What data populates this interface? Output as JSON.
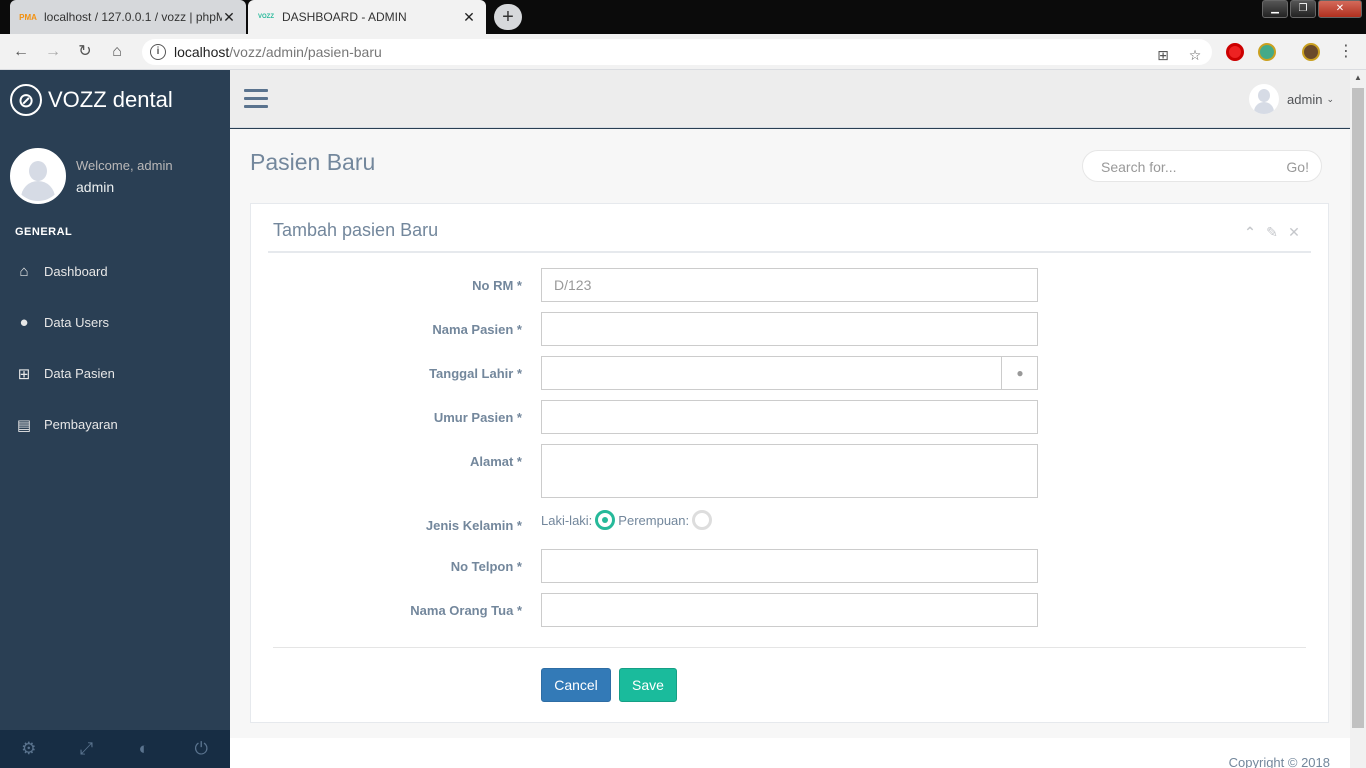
{
  "browser": {
    "tabs": [
      {
        "title": "localhost / 127.0.0.1 / vozz | phpMyAdmin",
        "favicon": "pma-icon",
        "active": false
      },
      {
        "title": "DASHBOARD - ADMIN",
        "favicon": "vozz-icon",
        "active": true
      }
    ],
    "url_host": "localhost",
    "url_path": "/vozz/admin/pasien-baru",
    "pma_favicon_text": "PMA",
    "vozz_favicon_text": "VOZZ"
  },
  "sidebar": {
    "brand": "VOZZ dental",
    "welcome": "Welcome, admin",
    "username": "admin",
    "section": "GENERAL",
    "items": [
      {
        "label": "Dashboard",
        "icon": "home-icon"
      },
      {
        "label": "Data Users",
        "icon": "user-icon"
      },
      {
        "label": "Data Pasien",
        "icon": "medkit-icon"
      },
      {
        "label": "Pembayaran",
        "icon": "file-icon"
      }
    ],
    "footer_icons": [
      "settings-icon",
      "fullscreen-icon",
      "lock-icon",
      "logout-icon"
    ]
  },
  "topnav": {
    "user": "admin"
  },
  "page": {
    "title": "Pasien Baru",
    "search_placeholder": "Search for...",
    "search_button": "Go!"
  },
  "panel": {
    "title": "Tambah pasien Baru",
    "fields": {
      "no_rm": {
        "label": "No RM *",
        "value": "",
        "placeholder": "D/123"
      },
      "nama": {
        "label": "Nama Pasien *",
        "value": ""
      },
      "tanggal": {
        "label": "Tanggal Lahir *",
        "value": ""
      },
      "umur": {
        "label": "Umur Pasien *",
        "value": ""
      },
      "alamat": {
        "label": "Alamat *",
        "value": ""
      },
      "jenis_kelamin": {
        "label": "Jenis Kelamin *",
        "option_male": "Laki-laki:",
        "option_female": "Perempuan:",
        "selected": "Laki-laki"
      },
      "telpon": {
        "label": "No Telpon *",
        "value": ""
      },
      "orang_tua": {
        "label": "Nama Orang Tua *",
        "value": ""
      }
    },
    "cancel_label": "Cancel",
    "save_label": "Save"
  },
  "footer": {
    "copyright": "Copyright © 2018"
  },
  "colors": {
    "sidebar": "#2A3F54",
    "accent": "#26B99A",
    "primary": "#337ab7"
  }
}
